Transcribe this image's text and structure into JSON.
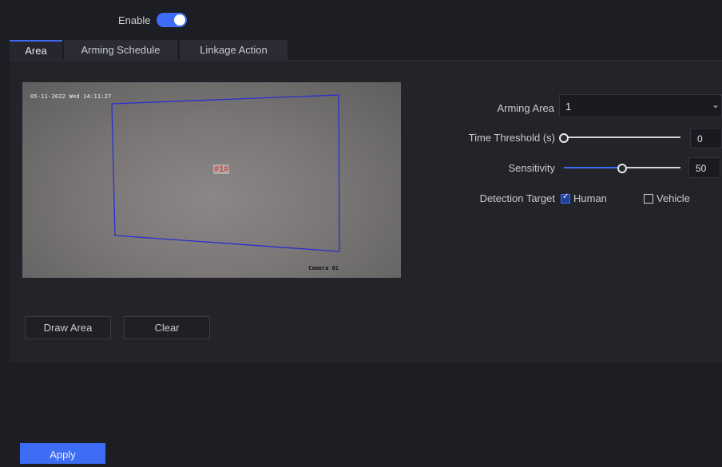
{
  "enable": {
    "label": "Enable",
    "on": true
  },
  "tabs": [
    {
      "label": "Area",
      "active": true
    },
    {
      "label": "Arming Schedule",
      "active": false
    },
    {
      "label": "Linkage Action",
      "active": false
    }
  ],
  "video": {
    "timestamp": "05-11-2022 Wed 14:11:27",
    "camera_name": "Camera 01",
    "area_label": "#1#",
    "area_outline_color": "#2b2fd0"
  },
  "buttons": {
    "draw_area": "Draw Area",
    "clear": "Clear",
    "apply": "Apply"
  },
  "settings": {
    "arming_area": {
      "label": "Arming Area",
      "value": "1"
    },
    "time_threshold": {
      "label": "Time Threshold (s)",
      "value": "0",
      "level": 0
    },
    "sensitivity": {
      "label": "Sensitivity",
      "value": "50",
      "level": 0.5
    },
    "detection_target": {
      "label": "Detection Target",
      "human": {
        "label": "Human",
        "checked": true
      },
      "vehicle": {
        "label": "Vehicle",
        "checked": false
      }
    }
  },
  "colors": {
    "accent": "#3d6df5",
    "background": "#1d1e24",
    "panel": "#232429"
  }
}
